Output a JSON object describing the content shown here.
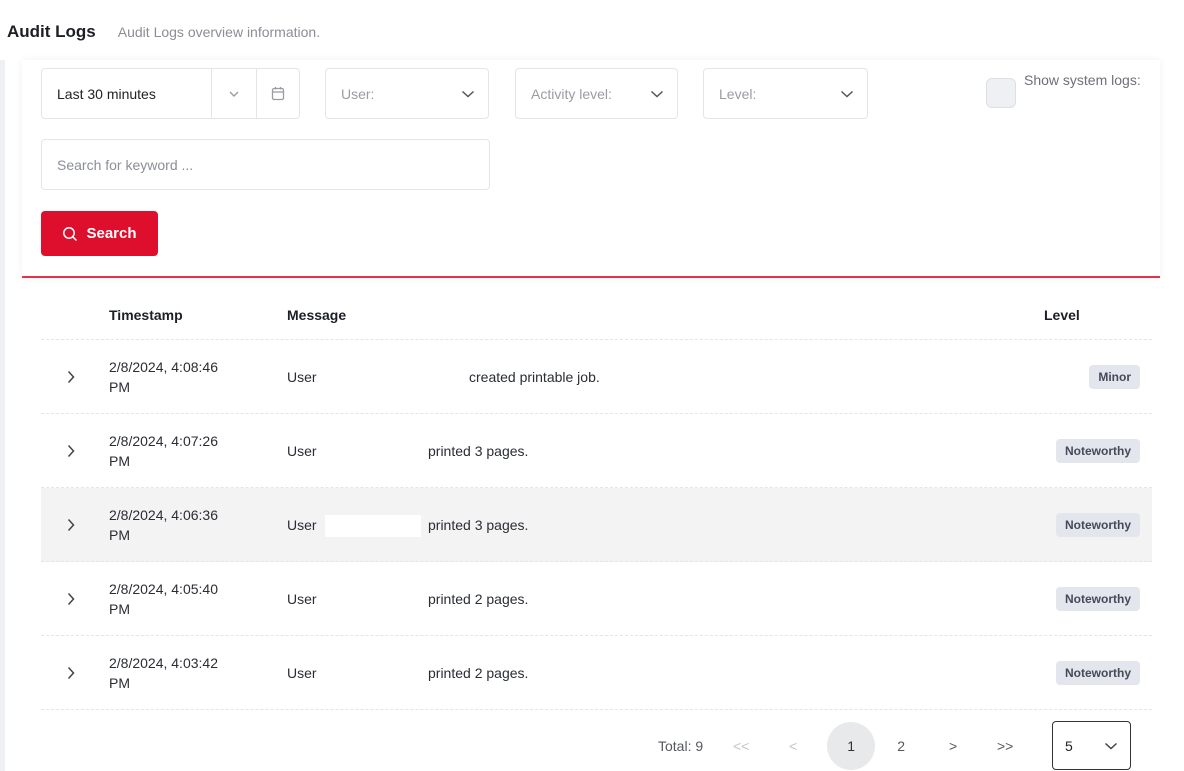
{
  "header": {
    "title": "Audit Logs",
    "subtitle": "Audit Logs overview information."
  },
  "filters": {
    "time_range": "Last 30 minutes",
    "user_label": "User:",
    "activity_label": "Activity level:",
    "level_label": "Level:",
    "show_system_logs_label": "Show system logs:",
    "show_system_logs_checked": false,
    "search_placeholder": "Search for keyword ...",
    "search_value": "",
    "search_button": "Search"
  },
  "table": {
    "columns": {
      "timestamp": "Timestamp",
      "message": "Message",
      "level": "Level"
    },
    "rows": [
      {
        "timestamp_date": "2/8/2024, 4:08:46",
        "timestamp_ampm": "PM",
        "user": "User",
        "message": "created printable job.",
        "level": "Minor"
      },
      {
        "timestamp_date": "2/8/2024, 4:07:26",
        "timestamp_ampm": "PM",
        "user": "User",
        "message": "printed 3 pages.",
        "level": "Noteworthy"
      },
      {
        "timestamp_date": "2/8/2024, 4:06:36",
        "timestamp_ampm": "PM",
        "user": "User",
        "message": "printed 3 pages.",
        "level": "Noteworthy"
      },
      {
        "timestamp_date": "2/8/2024, 4:05:40",
        "timestamp_ampm": "PM",
        "user": "User",
        "message": "printed 2 pages.",
        "level": "Noteworthy"
      },
      {
        "timestamp_date": "2/8/2024, 4:03:42",
        "timestamp_ampm": "PM",
        "user": "User",
        "message": "printed 2 pages.",
        "level": "Noteworthy"
      }
    ]
  },
  "pagination": {
    "total": "Total: 9",
    "first": "<<",
    "prev": "<",
    "pages": [
      "1",
      "2"
    ],
    "current_page": "1",
    "next": ">",
    "last": ">>",
    "page_size": "5"
  },
  "colors": {
    "accent": "#dd0f2c",
    "badge_bg": "#e4e6ee"
  }
}
